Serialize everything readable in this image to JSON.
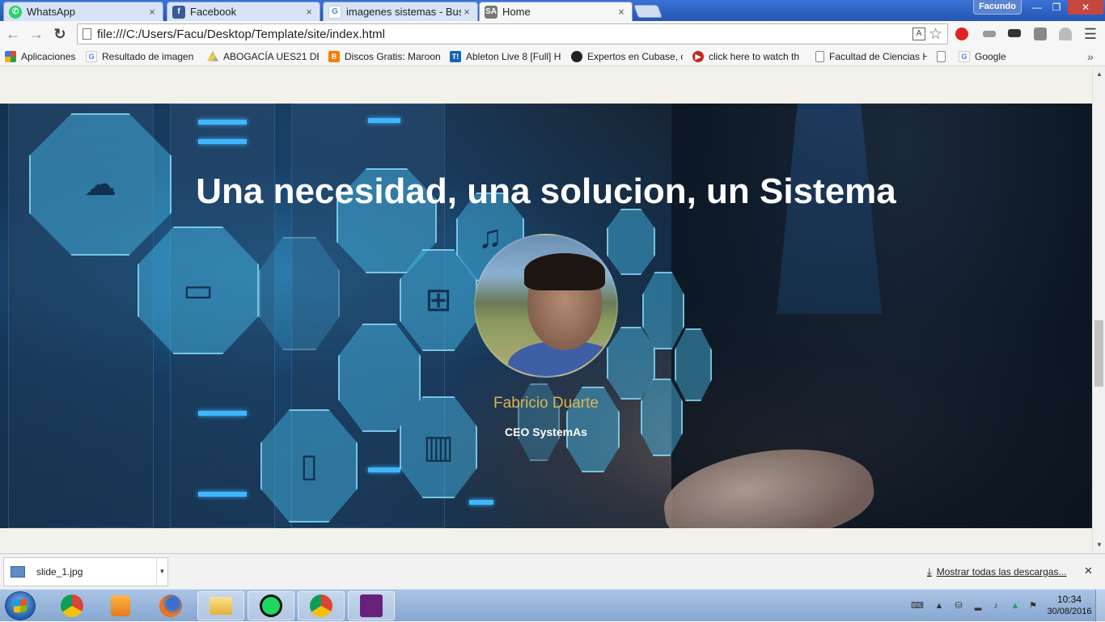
{
  "window": {
    "profile_name": "Facundo",
    "controls": {
      "minimize": "—",
      "maximize": "❐",
      "close": "✕"
    }
  },
  "tabs": [
    {
      "label": "WhatsApp",
      "favicon": "whatsapp-icon",
      "favicon_color": "#25d366",
      "active": false
    },
    {
      "label": "Facebook",
      "favicon": "facebook-icon",
      "favicon_color": "#3b5998",
      "active": false
    },
    {
      "label": "imagenes sistemas - Busc",
      "favicon": "google-icon",
      "favicon_color": "#4285f4",
      "active": false
    },
    {
      "label": "Home",
      "favicon": "sa-icon",
      "favicon_text": "SA",
      "favicon_color": "#777777",
      "active": true
    }
  ],
  "tab_close": "×",
  "toolbar": {
    "url": "file:///C:/Users/Facu/Desktop/Template/site/index.html",
    "back": "←",
    "forward": "→",
    "reload": "↻",
    "star": "☆",
    "menu": "☰"
  },
  "bookmarks": [
    {
      "label": "Aplicaciones",
      "icon": "apps-grid-icon",
      "color": "#d94c2f"
    },
    {
      "label": "Resultado de imagen",
      "icon": "google-icon",
      "color": "#4285f4"
    },
    {
      "label": "ABOGACÍA UES21 DE",
      "icon": "drive-icon",
      "color": "#1fa463"
    },
    {
      "label": "Discos Gratis: Maroon",
      "icon": "blogger-icon",
      "color": "#f57d00"
    },
    {
      "label": "Ableton Live 8 [Full] H",
      "icon": "taringa-icon",
      "color": "#1463b4"
    },
    {
      "label": "Expertos en Cubase, c",
      "icon": "cubase-icon",
      "color": "#222222"
    },
    {
      "label": "click here to watch th",
      "icon": "play-icon",
      "color": "#c4281c"
    },
    {
      "label": "Facultad de Ciencias H",
      "icon": "page-icon",
      "color": "#888888"
    },
    {
      "label": "",
      "icon": "page-icon",
      "color": "#888888"
    },
    {
      "label": "Google",
      "icon": "google-icon",
      "color": "#4285f4"
    }
  ],
  "bookmarks_overflow": "»",
  "hero": {
    "title": "Una necesidad, una solucion, un Sistema",
    "person_name": "Fabricio Duarte",
    "person_role": "CEO SystemAs"
  },
  "colors": {
    "accent_name": "#d9b64e",
    "chrome_blue": "#2b5fbf"
  },
  "downloads": {
    "file_name": "slide_1.jpg",
    "show_all": "Mostrar todas las descargas...",
    "close": "✕"
  },
  "taskbar": {
    "apps": [
      "chrome-icon",
      "media-player-icon",
      "firefox-icon",
      "file-explorer-icon",
      "spotify-icon",
      "chrome-icon",
      "visual-studio-icon"
    ],
    "clock_time": "10:34",
    "clock_date": "30/08/2016"
  }
}
